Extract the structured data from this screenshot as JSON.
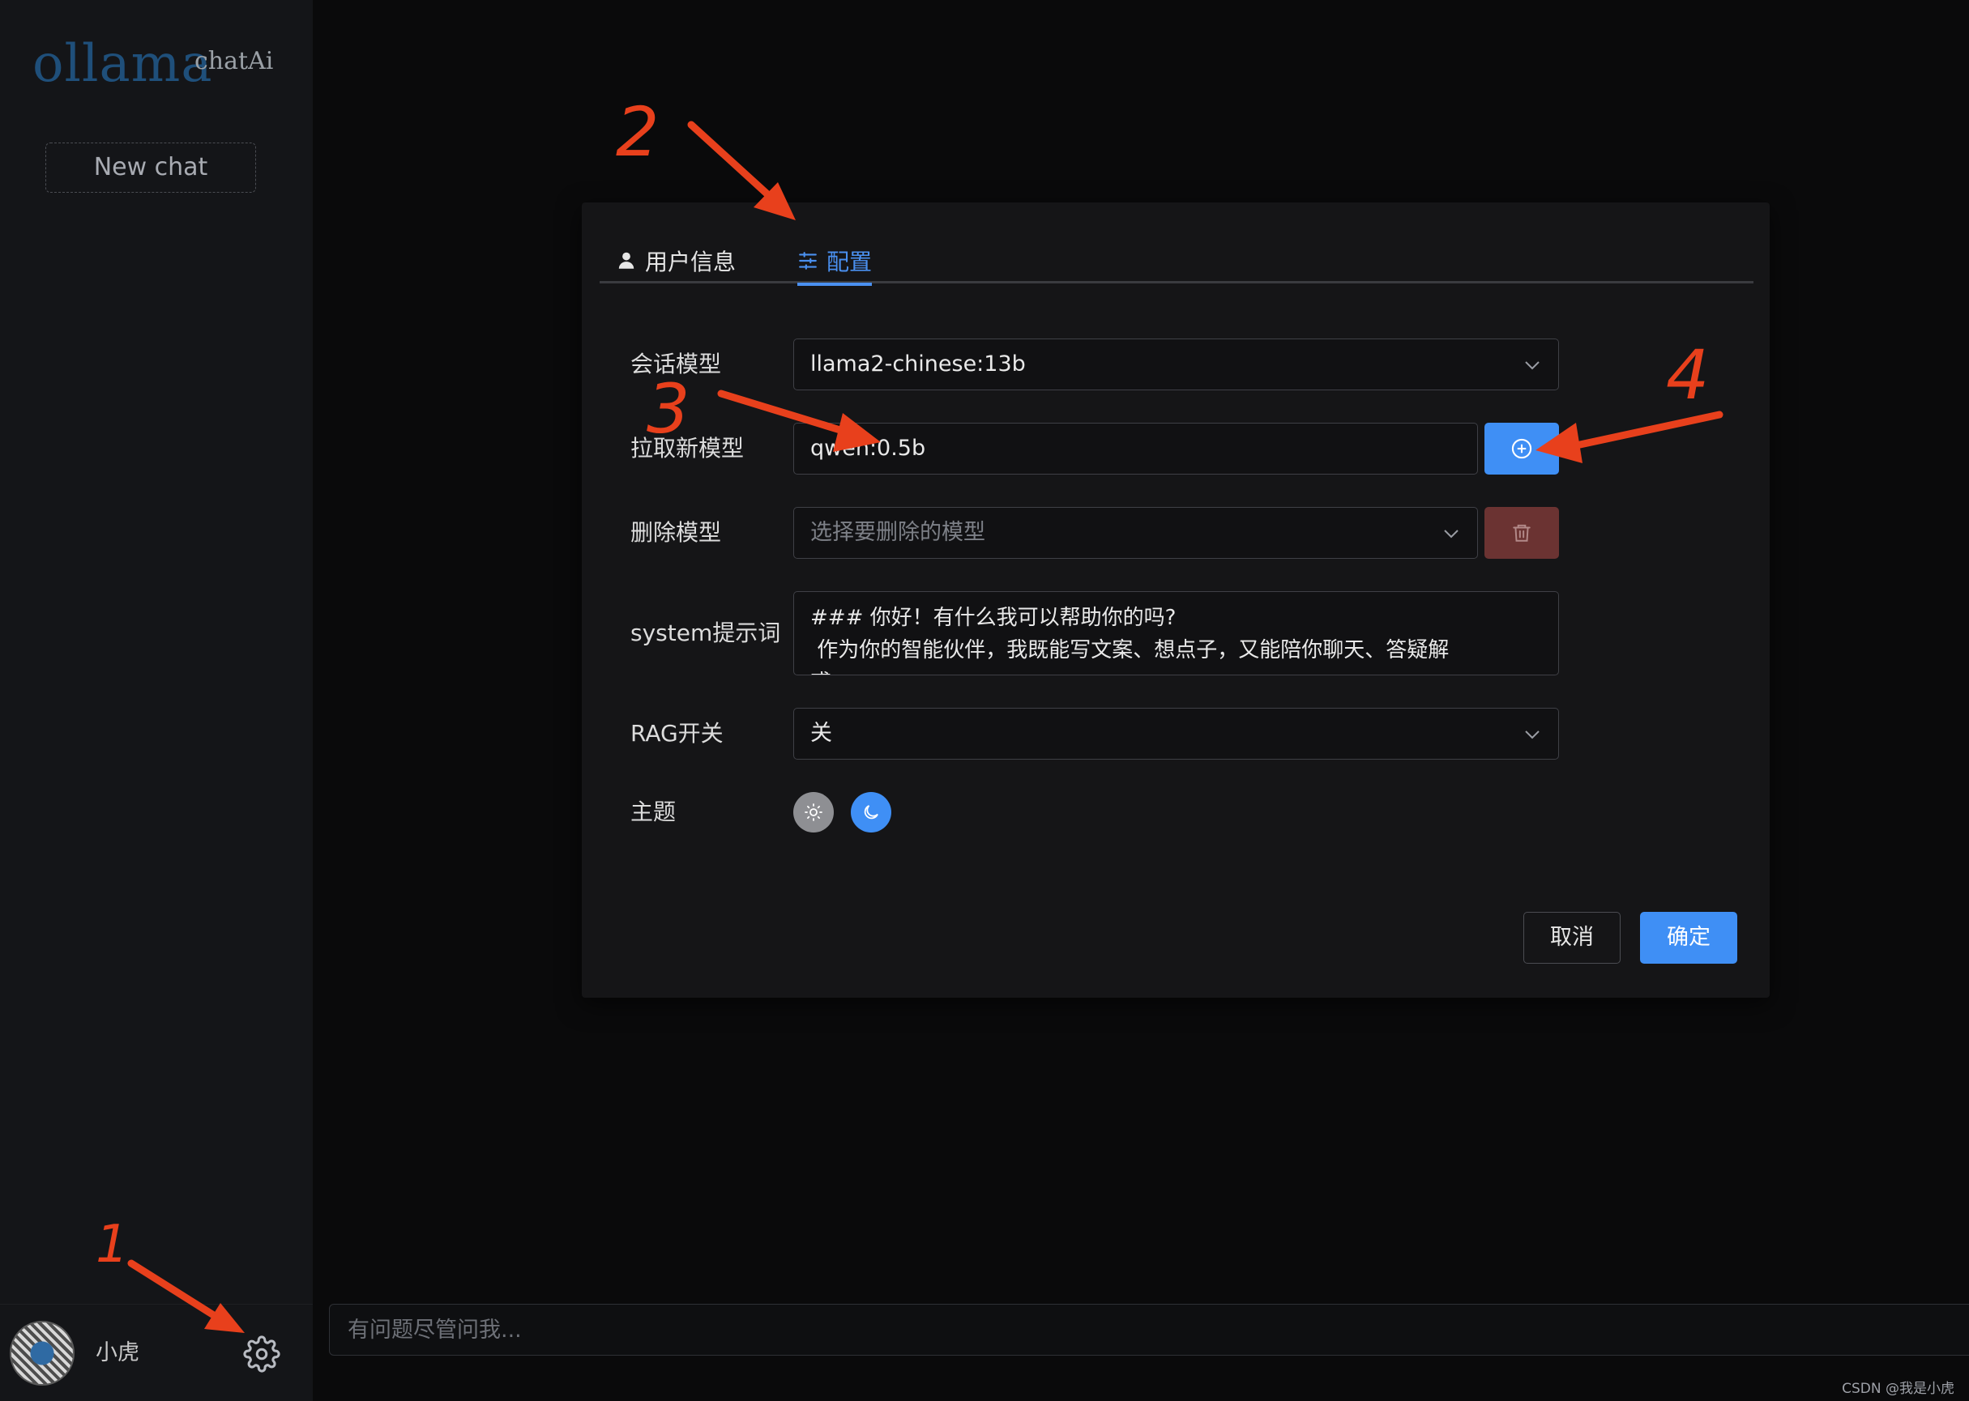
{
  "sidebar": {
    "logo_main": "ollama",
    "logo_sub": "chatAi",
    "new_chat_label": "New chat",
    "username": "小虎"
  },
  "chat": {
    "input_placeholder": "有问题尽管问我..."
  },
  "watermark": "CSDN @我是小虎",
  "modal": {
    "tabs": [
      {
        "label": "用户信息",
        "icon": "user-icon",
        "active": false
      },
      {
        "label": "配置",
        "icon": "sliders-icon",
        "active": true
      }
    ],
    "form": {
      "chat_model_label": "会话模型",
      "chat_model_value": "llama2-chinese:13b",
      "pull_model_label": "拉取新模型",
      "pull_model_value": "qwen:0.5b",
      "delete_model_label": "删除模型",
      "delete_model_placeholder": "选择要删除的模型",
      "system_prompt_label": "system提示词",
      "system_prompt_value": "### 你好！有什么我可以帮助你的吗?\n 作为你的智能伙伴，我既能写文案、想点子，又能陪你聊天、答疑解\n惑",
      "rag_label": "RAG开关",
      "rag_value": "关",
      "theme_label": "主题"
    },
    "cancel_label": "取消",
    "ok_label": "确定"
  },
  "annotations": [
    "1",
    "2",
    "3",
    "4"
  ],
  "colors": {
    "accent": "#3f8ff5",
    "danger": "#6b3332",
    "annotation": "#e8401c"
  }
}
